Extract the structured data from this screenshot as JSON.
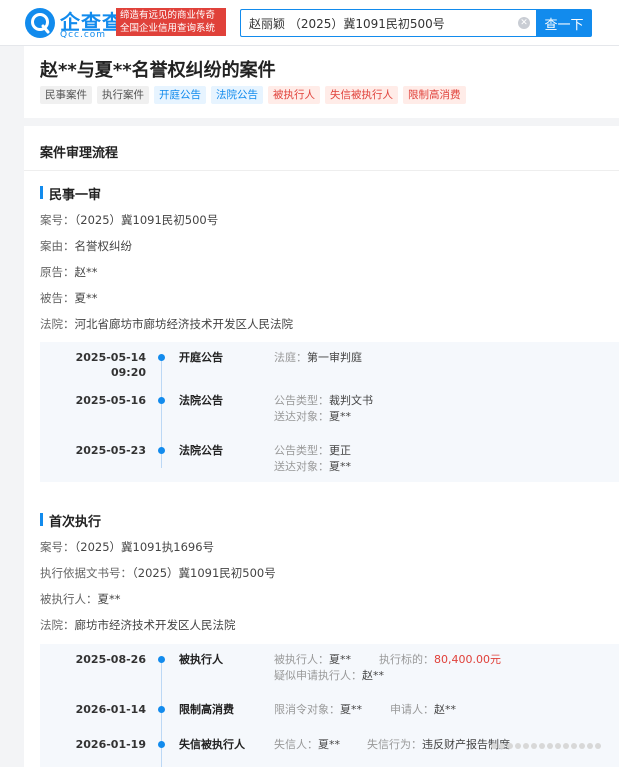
{
  "header": {
    "logo_text": "企查查",
    "logo_domain": "Qcc.com",
    "slogan_line1": "缔造有远见的商业传奇",
    "slogan_line2": "全国企业信用查询系统",
    "search_value": "赵丽颖 （2025）冀1091民初500号",
    "search_button": "查一下",
    "brand_color": "#128bed"
  },
  "case": {
    "title": "赵**与夏**名誉权纠纷的案件",
    "tags": [
      {
        "label": "民事案件",
        "style": "gray"
      },
      {
        "label": "执行案件",
        "style": "gray"
      },
      {
        "label": "开庭公告",
        "style": "blue"
      },
      {
        "label": "法院公告",
        "style": "blue"
      },
      {
        "label": "被执行人",
        "style": "red"
      },
      {
        "label": "失信被执行人",
        "style": "red"
      },
      {
        "label": "限制高消费",
        "style": "red"
      }
    ]
  },
  "flow": {
    "section_title": "案件审理流程",
    "first_instance": {
      "title": "民事一审",
      "case_no_label": "案号：",
      "case_no": "（2025）冀1091民初500号",
      "cause_label": "案由：",
      "cause": "名誉权纠纷",
      "plaintiff_label": "原告：",
      "plaintiff": "赵**",
      "defendant_label": "被告：",
      "defendant": "夏**",
      "court_label": "法院：",
      "court": "河北省廊坊市廊坊经济技术开发区人民法院",
      "events": [
        {
          "date": "2025-05-14",
          "time": "09:20",
          "type": "开庭公告",
          "k1": "法庭：",
          "v1": "第一审判庭"
        },
        {
          "date": "2025-05-16",
          "type": "法院公告",
          "k1": "公告类型：",
          "v1": "裁判文书",
          "k2": "送达对象：",
          "v2": "夏**"
        },
        {
          "date": "2025-05-23",
          "type": "法院公告",
          "k1": "公告类型：",
          "v1": "更正",
          "k2": "送达对象：",
          "v2": "夏**"
        }
      ]
    },
    "execution": {
      "title": "首次执行",
      "case_no_label": "案号：",
      "case_no": "（2025）冀1091执1696号",
      "basis_label": "执行依据文书号：",
      "basis": "（2025）冀1091民初500号",
      "executed_label": "被执行人：",
      "executed": "夏**",
      "court_label": "法院：",
      "court": "廊坊市经济技术开发区人民法院",
      "events": [
        {
          "date": "2025-08-26",
          "type": "被执行人",
          "k1": "被执行人：",
          "v1": "夏**",
          "k2": "执行标的：",
          "v2": "80,400.00元",
          "k3": "疑似申请执行人：",
          "v3": "赵**"
        },
        {
          "date": "2026-01-14",
          "type": "限制高消费",
          "k1": "限消令对象：",
          "v1": "夏**",
          "k2": "申请人：",
          "v2": "赵**"
        },
        {
          "date": "2026-01-19",
          "type": "失信被执行人",
          "k1": "失信人：",
          "v1": "夏**",
          "k2": "失信行为：",
          "v2": "违反财产报告制度"
        }
      ]
    }
  }
}
